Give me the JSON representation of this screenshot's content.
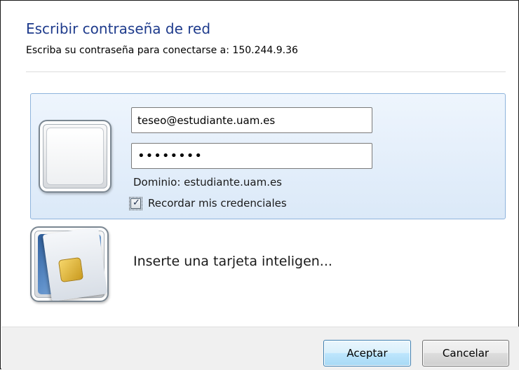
{
  "dialog": {
    "title": "Escribir contraseña de red",
    "subtitle": "Escriba su contraseña para conectarse a: 150.244.9.36"
  },
  "credentials": {
    "username_value": "teseo@estudiante.uam.es",
    "password_mask": "••••••••",
    "domain_text": "Dominio: estudiante.uam.es",
    "remember_label": "Recordar mis credenciales",
    "remember_checked": true
  },
  "smartcard": {
    "label": "Inserte una tarjeta inteligen..."
  },
  "buttons": {
    "ok_label": "Aceptar",
    "cancel_label": "Cancelar"
  },
  "icons": {
    "user_tile": "user-tile-icon",
    "smartcard": "smart-card-icon",
    "checkmark": "checkmark-icon"
  },
  "colors": {
    "title": "#1e3b8c",
    "selected_tile_border": "#8fb4dc",
    "selected_tile_bg": "#dbe9f8",
    "ok_button_border": "#3c7fb1"
  }
}
